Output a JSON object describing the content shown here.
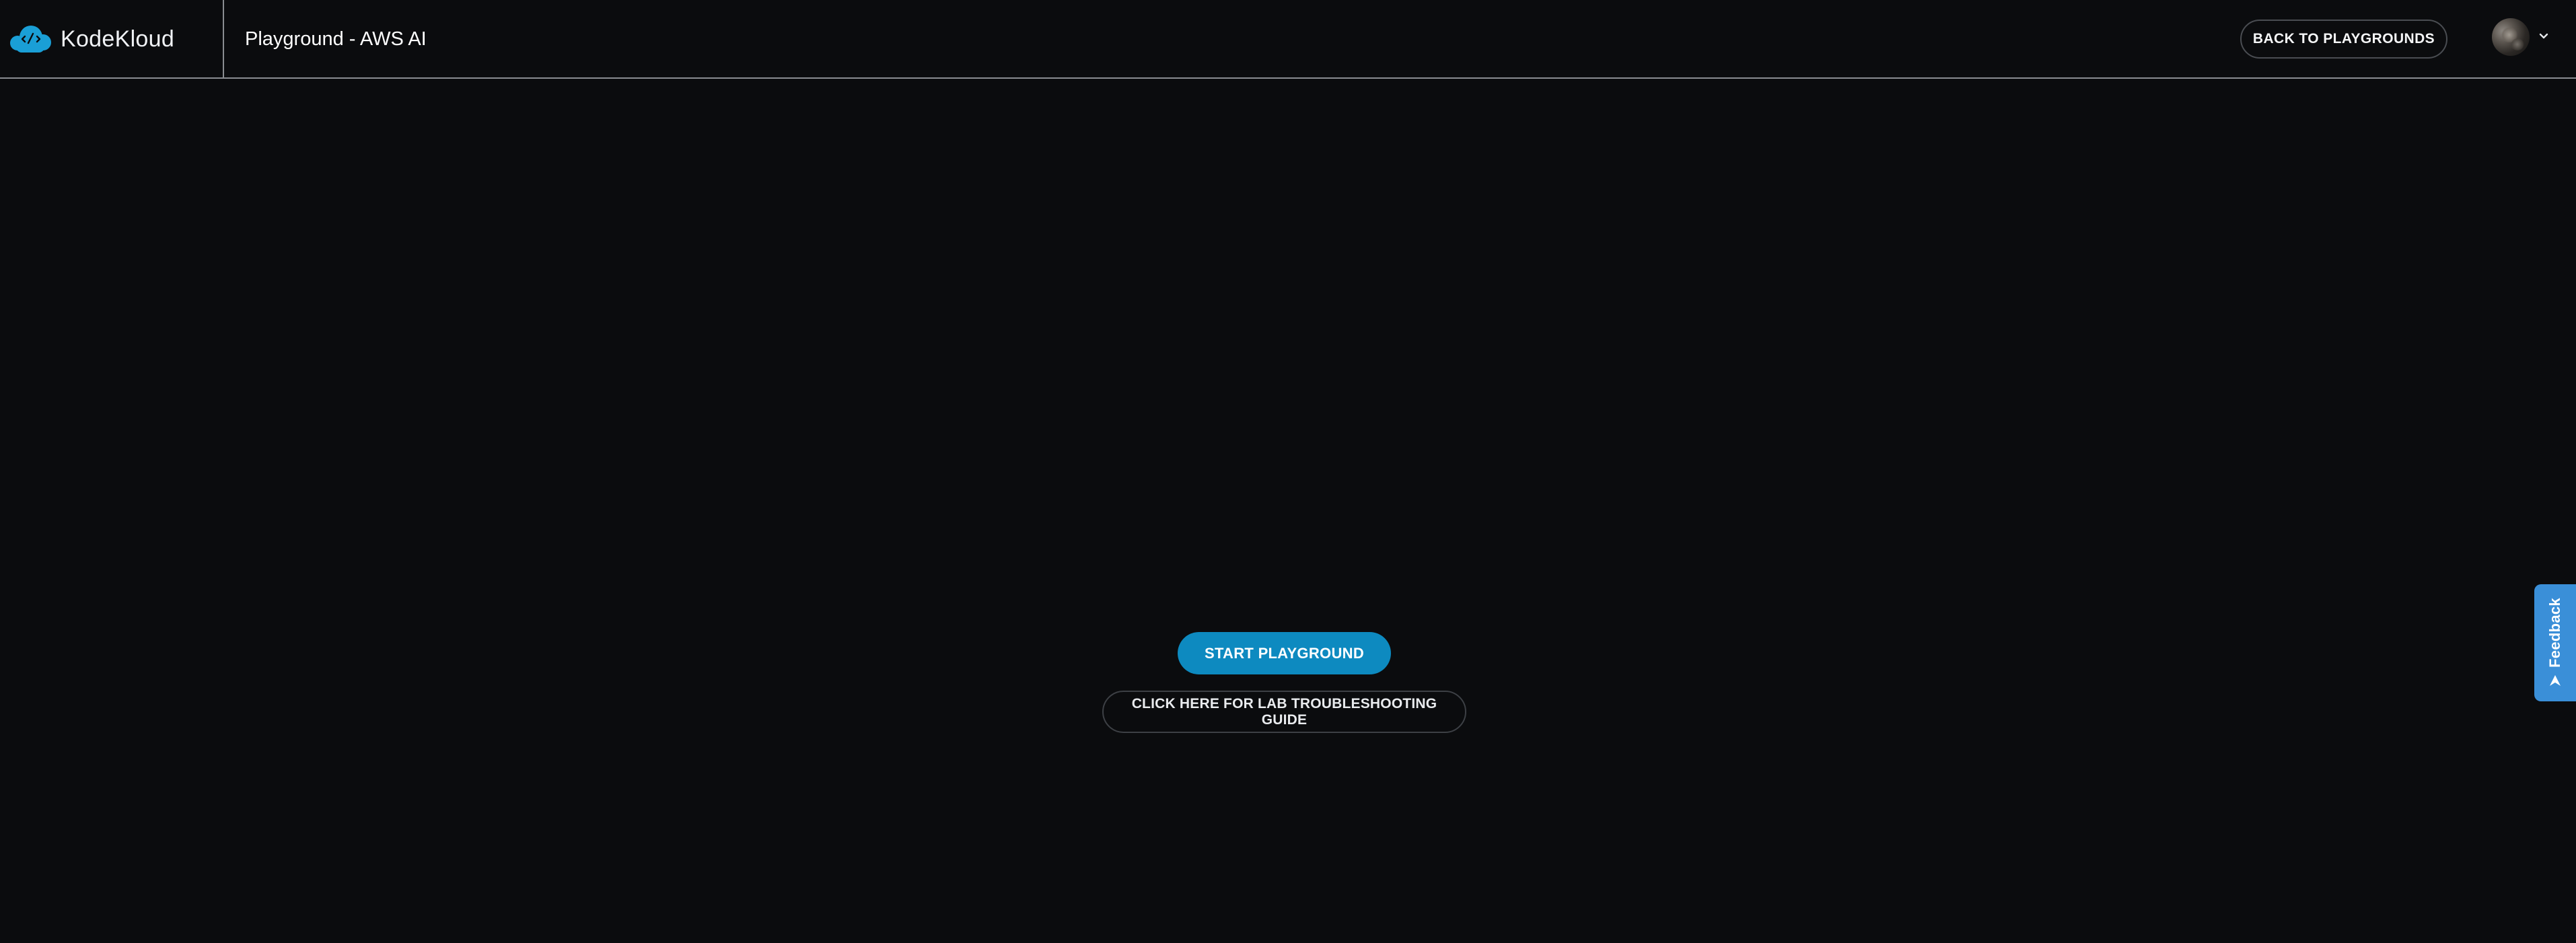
{
  "header": {
    "brand": {
      "name": "KodeKloud",
      "logo_icon": "kodekloud-cloud-logo-icon"
    },
    "title": "Playground - AWS AI",
    "back_button": "BACK TO PLAYGROUNDS",
    "user_menu": {
      "avatar_icon": "user-avatar",
      "chevron_icon": "chevron-down-icon"
    }
  },
  "main": {
    "start_button": "START PLAYGROUND",
    "guide_button": "CLICK HERE FOR LAB TROUBLESHOOTING GUIDE"
  },
  "feedback_tab": {
    "label": "Feedback",
    "icon": "send-arrow-icon"
  },
  "colors": {
    "background": "#0b0c0e",
    "accent": "#0d8ac0",
    "feedback": "#3a8fd8",
    "divider": "#8a8d91"
  }
}
